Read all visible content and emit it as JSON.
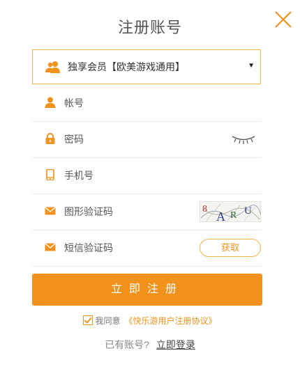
{
  "title": "注册账号",
  "membership": {
    "selected": "独享会员【欧美游戏通用】"
  },
  "form": {
    "account_placeholder": "帐号",
    "password_placeholder": "密码",
    "phone_placeholder": "手机号",
    "captcha_placeholder": "图形验证码",
    "captcha_text": "8ARU",
    "sms_placeholder": "短信验证码",
    "get_code_label": "获取"
  },
  "submit_label": "立即注册",
  "agreement": {
    "prefix": "我同意",
    "link": "《快乐游用户注册协议》"
  },
  "login": {
    "prompt": "已有账号?",
    "link": "立即登录"
  },
  "colors": {
    "accent": "#f0921b",
    "border": "#f0b648"
  },
  "icons": [
    "close-icon",
    "users-icon",
    "caret-down-icon",
    "user-icon",
    "lock-icon",
    "eye-closed-icon",
    "phone-icon",
    "envelope-icon"
  ]
}
